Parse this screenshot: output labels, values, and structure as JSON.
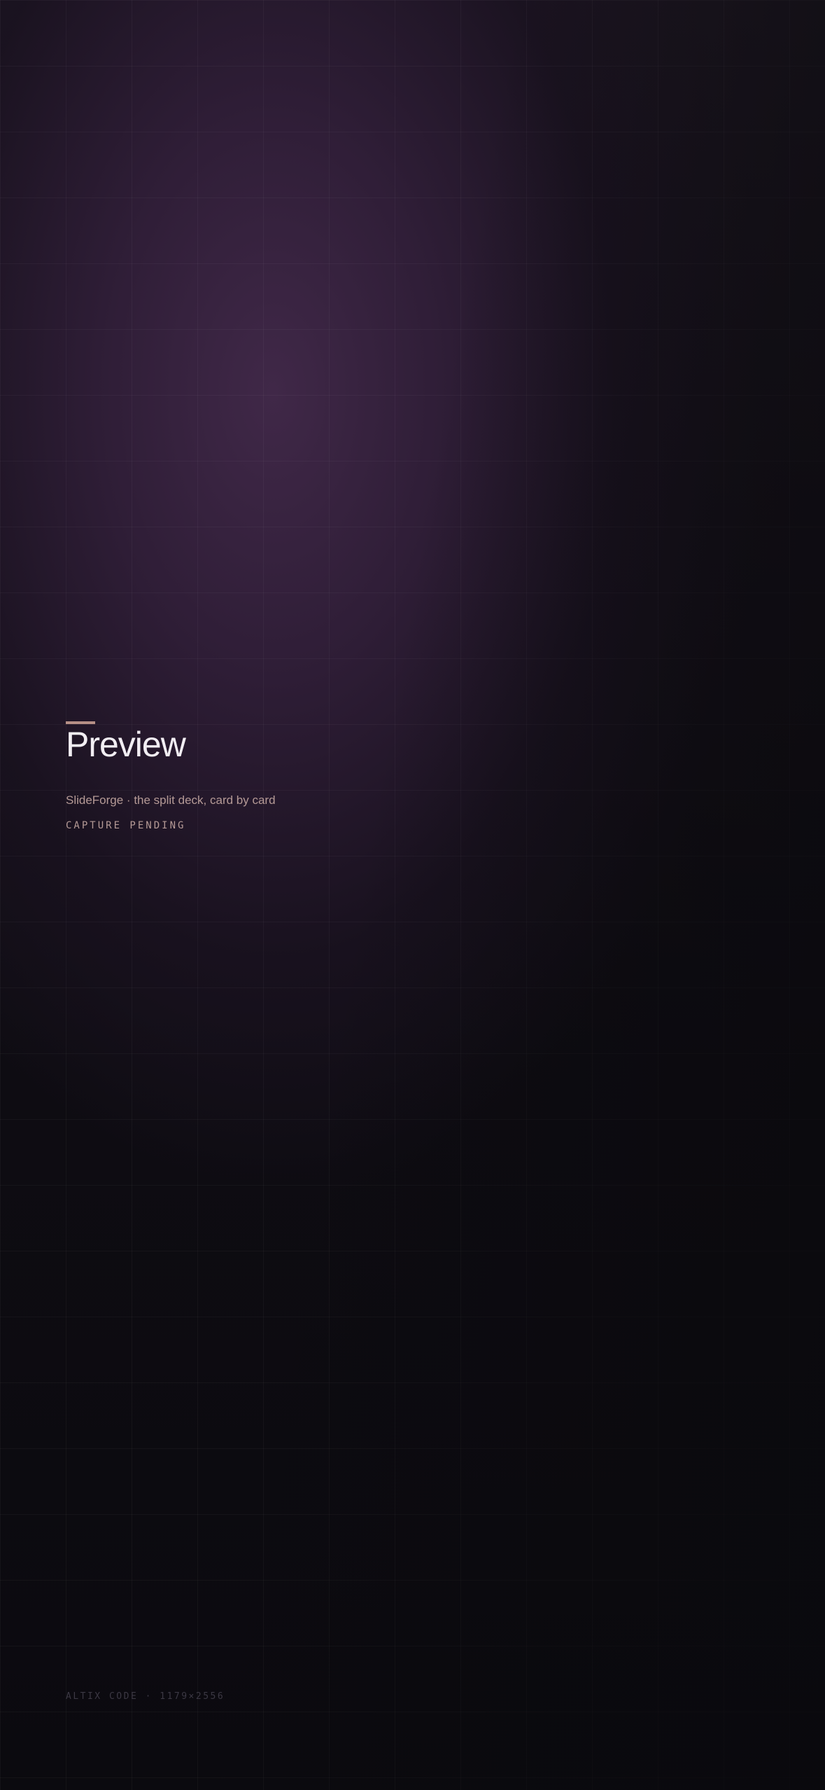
{
  "preview": {
    "title": "Preview",
    "subtitle": "SlideForge · the split deck, card by card",
    "status": "CAPTURE PENDING"
  },
  "footer": {
    "text": "ALTIX CODE · 1179×2556"
  },
  "colors": {
    "accent": "#b58f86",
    "title": "#f2eef3",
    "background": "#0b0a0f",
    "glow": "#402848"
  }
}
